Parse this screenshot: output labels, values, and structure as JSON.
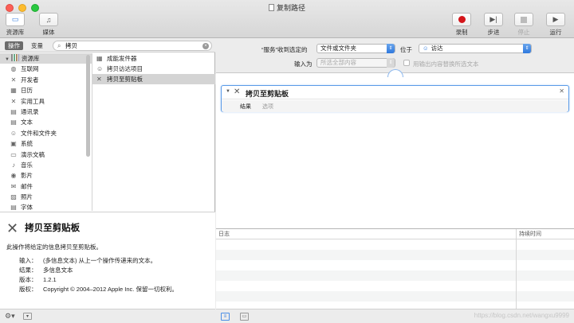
{
  "window": {
    "title": "复制路径"
  },
  "toolbar": {
    "library_label": "资源库",
    "media_label": "媒体",
    "record_label": "录制",
    "step_label": "步进",
    "stop_label": "停止",
    "run_label": "运行"
  },
  "library": {
    "tab_actions": "操作",
    "tab_variables": "变量",
    "search_value": "拷贝",
    "root_label": "资源库",
    "categories": [
      {
        "label": "互联网",
        "icon": "globe-icon",
        "glyph": "◍"
      },
      {
        "label": "开发者",
        "icon": "tools-icon",
        "glyph": "✕"
      },
      {
        "label": "日历",
        "icon": "calendar-icon",
        "glyph": "▦"
      },
      {
        "label": "实用工具",
        "icon": "utilities-icon",
        "glyph": "✕"
      },
      {
        "label": "通讯录",
        "icon": "contacts-icon",
        "glyph": "▤"
      },
      {
        "label": "文本",
        "icon": "text-icon",
        "glyph": "▤"
      },
      {
        "label": "文件和文件夹",
        "icon": "finder-icon",
        "glyph": "☺"
      },
      {
        "label": "系统",
        "icon": "system-icon",
        "glyph": "▣"
      },
      {
        "label": "演示文稿",
        "icon": "presentation-icon",
        "glyph": "▭"
      },
      {
        "label": "音乐",
        "icon": "music-icon",
        "glyph": "♪"
      },
      {
        "label": "影片",
        "icon": "movie-icon",
        "glyph": "◉"
      },
      {
        "label": "邮件",
        "icon": "mail-icon",
        "glyph": "✉"
      },
      {
        "label": "照片",
        "icon": "photos-icon",
        "glyph": "▨"
      },
      {
        "label": "字体",
        "icon": "font-icon",
        "glyph": "▤"
      }
    ],
    "actions": [
      {
        "label": "成能发件器",
        "icon": "generator-icon",
        "glyph": "▦"
      },
      {
        "label": "拷贝访达项目",
        "icon": "finder-icon",
        "glyph": "☺"
      },
      {
        "label": "拷贝至剪贴板",
        "icon": "clipboard-tool-icon",
        "glyph": "✕"
      }
    ]
  },
  "description": {
    "title": "拷贝至剪贴板",
    "summary": "此操作将给定的信息拷贝至剪贴板。",
    "rows": [
      {
        "key": "输入：",
        "value": "(多信息文本) 从上一个操作传递来的文本。"
      },
      {
        "key": "结果：",
        "value": "多信息文本"
      },
      {
        "key": "版本：",
        "value": "1.2.1"
      },
      {
        "key": "版权：",
        "value": "Copyright © 2004–2012 Apple Inc. 保留一切权利。"
      }
    ]
  },
  "service": {
    "receives_label": "“服务”收到选定的",
    "receives_value": "文件或文件夹",
    "location_label": "位于",
    "location_value": "访达",
    "input_label": "输入为",
    "input_value": "所选全部内容",
    "replace_label": "用输出内容替换所选文本"
  },
  "workflow": {
    "action_title": "拷贝至剪贴板",
    "results_label": "结果",
    "options_label": "选项"
  },
  "log": {
    "col_log": "日志",
    "col_duration": "持续时间"
  },
  "watermark": "https://blog.csdn.net/wangxu9999"
}
